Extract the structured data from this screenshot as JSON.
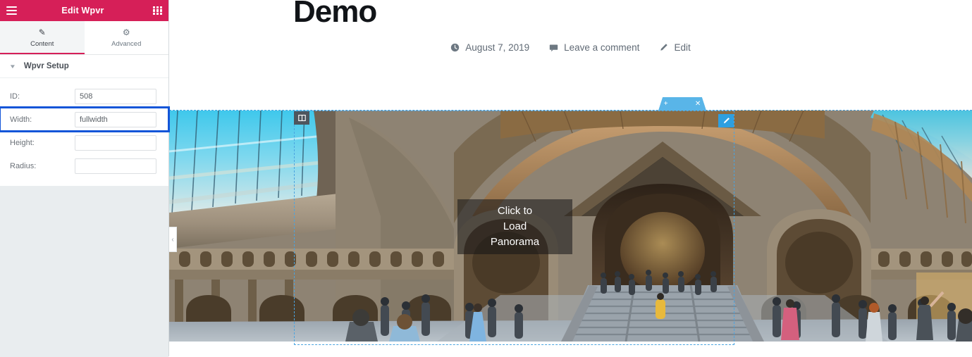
{
  "panel": {
    "header": {
      "title": "Edit Wpvr",
      "menu_icon": "hamburger-icon",
      "apps_icon": "grid-apps-icon"
    },
    "tabs": [
      {
        "label": "Content",
        "icon": "pencil-icon",
        "glyph": "✎",
        "active": true
      },
      {
        "label": "Advanced",
        "icon": "gear-icon",
        "glyph": "⚙",
        "active": false
      }
    ],
    "section": {
      "title": "Wpvr Setup",
      "chevron": "▼",
      "expanded": true
    },
    "fields": [
      {
        "label": "ID:",
        "value": "508",
        "placeholder": "",
        "highlighted": false
      },
      {
        "label": "Width:",
        "value": "fullwidth",
        "placeholder": "",
        "highlighted": true
      },
      {
        "label": "Height:",
        "value": "",
        "placeholder": "",
        "highlighted": false
      },
      {
        "label": "Radius:",
        "value": "",
        "placeholder": "",
        "highlighted": false
      }
    ],
    "collapse_arrow": "‹",
    "colors": {
      "header_pink": "#d61f58",
      "panel_bg": "#e9edef",
      "highlight_blue": "#1355d8"
    }
  },
  "preview": {
    "post": {
      "title": "Demo",
      "meta": [
        {
          "label": "August 7, 2019",
          "icon": "clock-icon"
        },
        {
          "label": "Leave a comment",
          "icon": "comment-icon"
        },
        {
          "label": "Edit",
          "icon": "pencil-icon"
        }
      ]
    },
    "section_toolbar": {
      "add": "+",
      "add_icon": "plus-icon",
      "drag_icon": "drag-dots-icon",
      "close": "✕",
      "close_icon": "close-icon",
      "color": "#59b5e8"
    },
    "widget": {
      "column_handle_icon": "column-handle-icon",
      "edit_badge_icon": "pencil-edit-icon",
      "overlay_lines": [
        "Click to",
        "Load",
        "Panorama"
      ],
      "selection_color": "#4aa3df"
    }
  }
}
